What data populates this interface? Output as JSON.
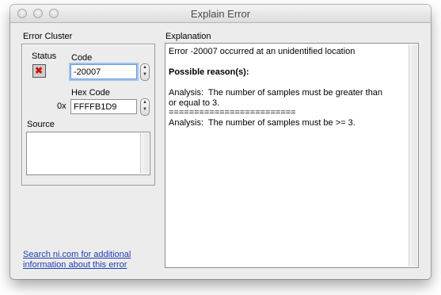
{
  "window": {
    "title": "Explain Error"
  },
  "error_cluster": {
    "heading": "Error Cluster",
    "status_label": "Status",
    "code_label": "Code",
    "code_value": "-20007",
    "hex_label": "Hex Code",
    "hex_prefix": "0x",
    "hex_value": "FFFFB1D9",
    "source_label": "Source",
    "source_value": ""
  },
  "explanation": {
    "heading": "Explanation",
    "line1": "Error -20007 occurred at an unidentified location",
    "line2": "Possible reason(s):",
    "line3": "Analysis:  The number of samples must be greater than",
    "line4": "or equal to 3.",
    "line5": "=========================",
    "line6": "Analysis:  The number of samples must be >= 3."
  },
  "link": {
    "line1": "Search ni.com for additional",
    "line2": "information about this error"
  }
}
